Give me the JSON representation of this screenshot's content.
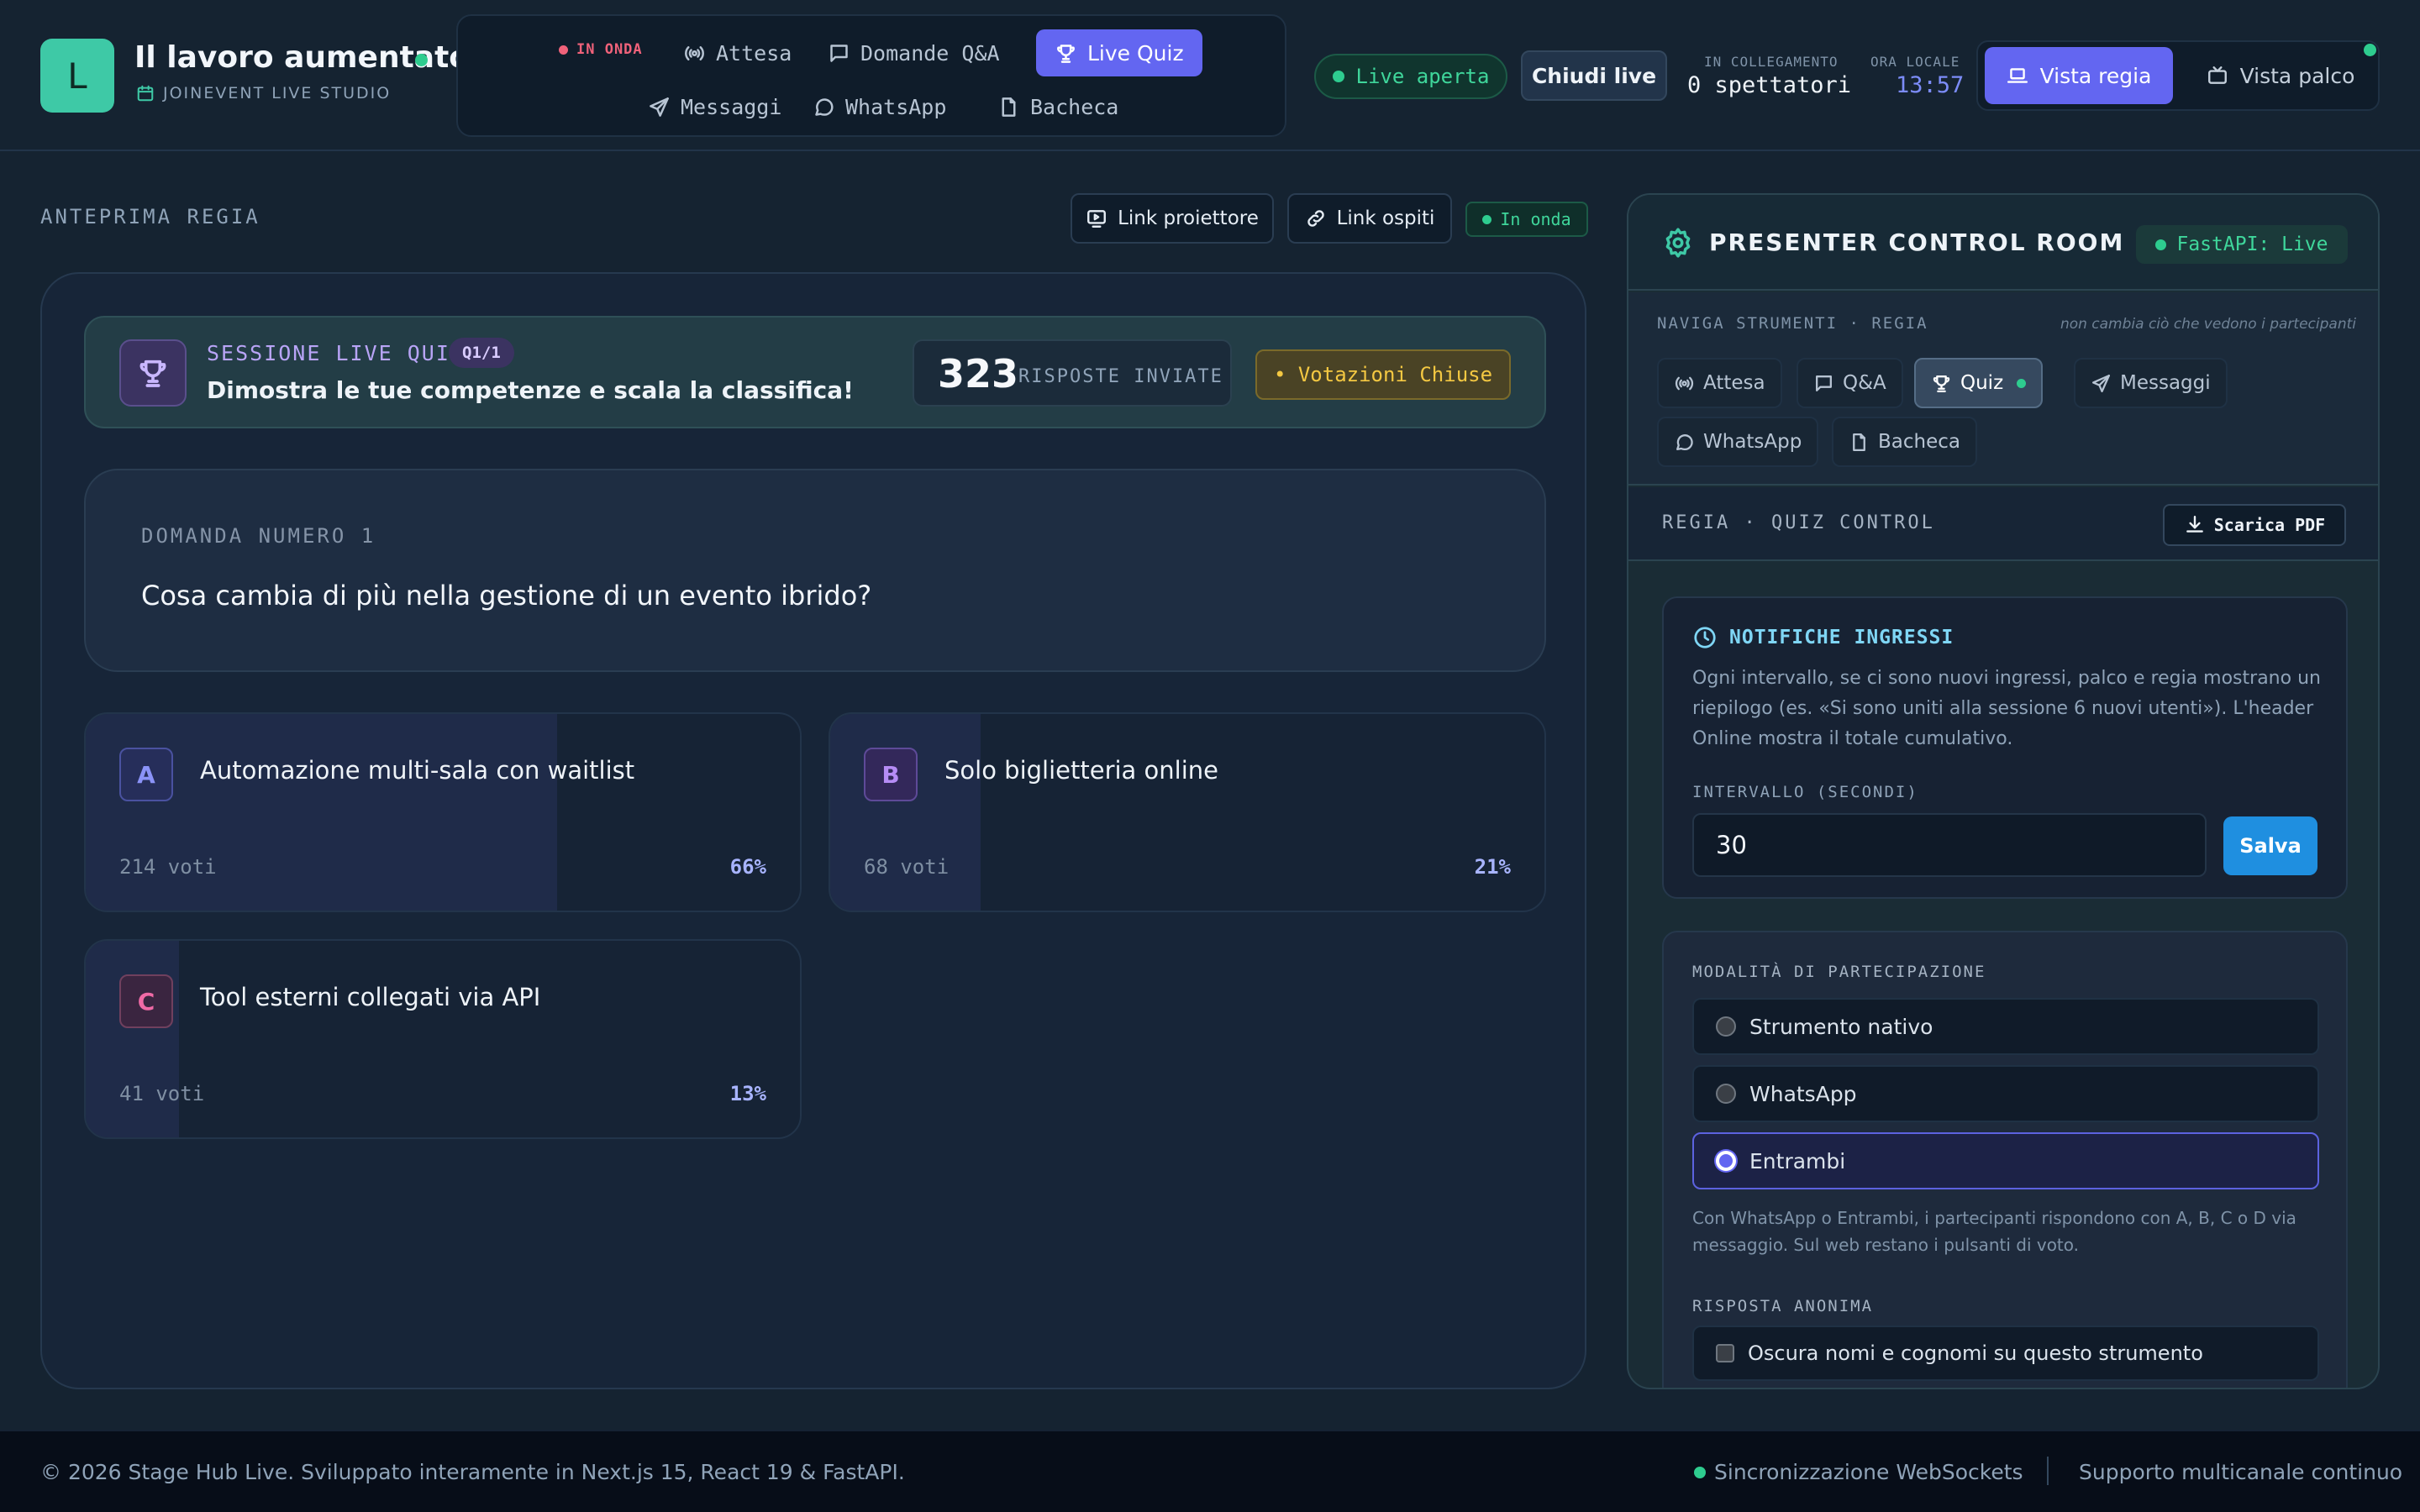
{
  "header": {
    "logo_letter": "L",
    "title": "Il lavoro aumentato",
    "studio": "JOINEVENT LIVE STUDIO",
    "on_air": "IN ONDA",
    "nav": [
      {
        "label": "Attesa",
        "icon": "broadcast-icon"
      },
      {
        "label": "Domande Q&A",
        "icon": "chat-icon"
      },
      {
        "label": "Live Quiz",
        "icon": "trophy-icon",
        "active": true
      },
      {
        "label": "Messaggi",
        "icon": "send-icon"
      },
      {
        "label": "WhatsApp",
        "icon": "whatsapp-icon"
      },
      {
        "label": "Bacheca",
        "icon": "file-icon"
      }
    ],
    "live_status": "Live aperta",
    "close_live": "Chiudi live",
    "connected_label": "IN COLLEGAMENTO",
    "connected_value": "0 spettatori",
    "local_time_label": "ORA LOCALE",
    "local_time": "13:57",
    "view_regia": "Vista regia",
    "view_palco": "Vista palco"
  },
  "preview": {
    "label": "ANTEPRIMA REGIA",
    "projector_link": "Link proiettore",
    "guests_link": "Link ospiti",
    "status": "In onda"
  },
  "session": {
    "title": "SESSIONE LIVE QUIZ",
    "tag": "Q1/1",
    "subtitle": "Dimostra le tue competenze e scala la classifica!",
    "responses": "323",
    "responses_label": "RISPOSTE INVIATE",
    "voting_status": "• Votazioni Chiuse"
  },
  "question": {
    "label": "DOMANDA NUMERO 1",
    "text": "Cosa cambia di più nella gestione di un evento ibrido?"
  },
  "options": [
    {
      "letter": "A",
      "text": "Automazione multi-sala con waitlist",
      "votes": "214 voti",
      "pct": "66%",
      "fraction": 0.66,
      "color": "#8b93f8",
      "bg": "#262e5a",
      "border": "#4a52a0"
    },
    {
      "letter": "B",
      "text": "Solo biglietteria online",
      "votes": "68 voti",
      "pct": "21%",
      "fraction": 0.21,
      "color": "#b68cf5",
      "bg": "#33285a",
      "border": "#5e4a98"
    },
    {
      "letter": "C",
      "text": "Tool esterni collegati via API",
      "votes": "41 voti",
      "pct": "13%",
      "fraction": 0.13,
      "color": "#f06aa6",
      "bg": "#3a2540",
      "border": "#70405e"
    }
  ],
  "panel": {
    "title": "PRESENTER CONTROL ROOM",
    "fastapi": "FastAPI: Live",
    "tools_label": "NAVIGA STRUMENTI · REGIA",
    "tools_note": "non cambia ciò che vedono i partecipanti",
    "tools": [
      {
        "label": "Attesa",
        "icon": "broadcast-icon"
      },
      {
        "label": "Q&A",
        "icon": "chat-icon"
      },
      {
        "label": "Quiz",
        "icon": "trophy-icon",
        "active": true
      },
      {
        "label": "Messaggi",
        "icon": "send-icon"
      },
      {
        "label": "WhatsApp",
        "icon": "whatsapp-icon"
      },
      {
        "label": "Bacheca",
        "icon": "file-icon"
      }
    ],
    "quiz_control_label": "REGIA · QUIZ CONTROL",
    "download_pdf": "Scarica PDF",
    "notif_title": "NOTIFICHE INGRESSI",
    "notif_desc": "Ogni intervallo, se ci sono nuovi ingressi, palco e regia mostrano un riepilogo (es. «Si sono uniti alla sessione 6 nuovi utenti»). L'header Online mostra il totale cumulativo.",
    "interval_label": "INTERVALLO (SECONDI)",
    "interval_value": "30",
    "save": "Salva",
    "mode_label": "MODALITÀ DI PARTECIPAZIONE",
    "modes": [
      {
        "label": "Strumento nativo",
        "selected": false
      },
      {
        "label": "WhatsApp",
        "selected": false
      },
      {
        "label": "Entrambi",
        "selected": true
      }
    ],
    "mode_note": "Con WhatsApp o Entrambi, i partecipanti rispondono con A, B, C o D via messaggio. Sul web restano i pulsanti di voto.",
    "anon_label": "RISPOSTA ANONIMA",
    "anon_check": "Oscura nomi e cognomi su questo strumento"
  },
  "footer": {
    "copyright": "© 2026 Stage Hub Live. Sviluppato interamente in Next.js 15, React 19 & FastAPI.",
    "ws_sync": "Sincronizzazione WebSockets",
    "support": "Supporto multicanale continuo"
  },
  "colors": {
    "accent": "#6366f1",
    "live": "#2ecc8f",
    "teal": "#3ec9a6",
    "warning": "#f4c842"
  }
}
